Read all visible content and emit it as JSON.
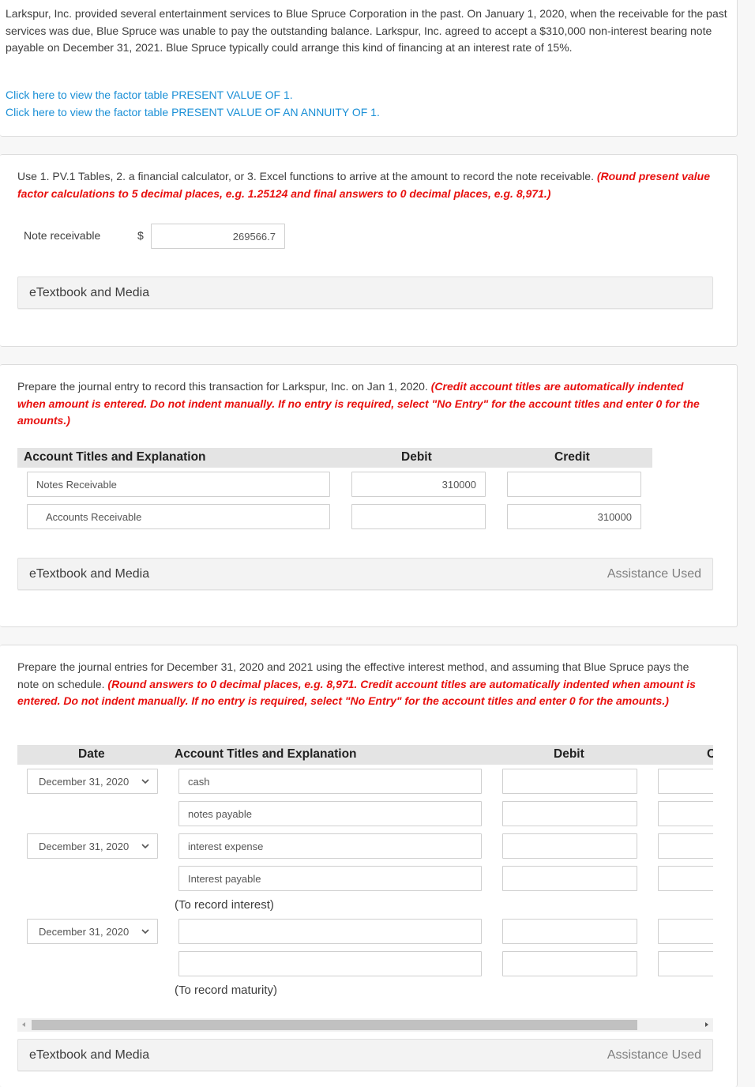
{
  "problem": {
    "intro": "Larkspur, Inc. provided several entertainment services to Blue Spruce Corporation in the past. On January 1, 2020, when the receivable for the past services was due, Blue Spruce was unable to pay the outstanding balance. Larkspur, Inc. agreed to accept a $310,000 non-interest bearing note payable on December 31, 2021. Blue Spruce typically could arrange this kind of financing at an interest rate of 15%.",
    "links": [
      "Click here to view the factor table PRESENT VALUE OF 1.",
      "Click here to view the factor table PRESENT VALUE OF AN ANNUITY OF 1."
    ]
  },
  "part1": {
    "instruction": "Use 1. PV.1 Tables, 2. a financial calculator, or 3. Excel functions to arrive at the amount to record the note receivable.",
    "instruction_red": "(Round present value factor calculations to 5 decimal places, e.g. 1.25124 and final answers to 0 decimal places, e.g. 8,971.)",
    "field_label": "Note receivable",
    "currency": "$",
    "field_value": "269566.7",
    "etextbook_label": "eTextbook and Media"
  },
  "part2": {
    "instruction": "Prepare the journal entry to record this transaction for Larkspur, Inc. on Jan 1, 2020.",
    "instruction_red": "(Credit account titles are automatically indented when amount is entered. Do not indent manually. If no entry is required, select \"No Entry\" for the account titles and enter 0 for the amounts.)",
    "headers": {
      "account": "Account Titles and Explanation",
      "debit": "Debit",
      "credit": "Credit"
    },
    "rows": [
      {
        "account": "Notes Receivable",
        "debit": "310000",
        "credit": ""
      },
      {
        "account": "Accounts Receivable",
        "debit": "",
        "credit": "310000"
      }
    ],
    "etextbook_label": "eTextbook and Media",
    "assistance_label": "Assistance Used"
  },
  "part3": {
    "instruction": "Prepare the journal entries for December 31, 2020 and 2021 using the effective interest method, and assuming that Blue Spruce pays the note on schedule.",
    "instruction_red": "(Round answers to 0 decimal places, e.g. 8,971. Credit account titles are automatically indented when amount is entered. Do not indent manually. If no entry is required, select \"No Entry\" for the account titles and enter 0 for the amounts.)",
    "headers": {
      "date": "Date",
      "account": "Account Titles and Explanation",
      "debit": "Debit",
      "credit": "C"
    },
    "entries": [
      {
        "date": "December 31, 2020",
        "rows": [
          {
            "account": "cash",
            "debit": "",
            "credit": ""
          },
          {
            "account": "notes payable",
            "debit": "",
            "credit": ""
          }
        ],
        "note": ""
      },
      {
        "date": "December 31, 2020",
        "rows": [
          {
            "account": "interest expense",
            "debit": "",
            "credit": ""
          },
          {
            "account": "Interest payable",
            "debit": "",
            "credit": ""
          }
        ],
        "note": "(To record interest)"
      },
      {
        "date": "December 31, 2020",
        "rows": [
          {
            "account": "",
            "debit": "",
            "credit": ""
          },
          {
            "account": "",
            "debit": "",
            "credit": ""
          }
        ],
        "note": "(To record maturity)"
      }
    ],
    "etextbook_label": "eTextbook and Media",
    "assistance_label": "Assistance Used"
  },
  "colors": {
    "link": "#1a8fd6",
    "instruction_red": "#e8110f",
    "header_bg": "#e4e4e4"
  }
}
